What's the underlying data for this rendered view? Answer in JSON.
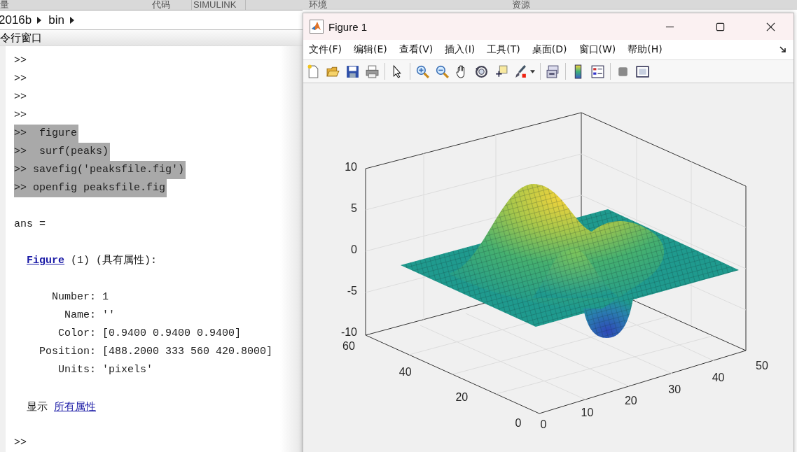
{
  "ribbon_tabs": [
    {
      "label": "量"
    },
    {
      "label": "代码"
    },
    {
      "label": "SIMULINK"
    },
    {
      "label": "环境"
    },
    {
      "label": "资源"
    }
  ],
  "breadcrumb": [
    "2016b",
    "bin"
  ],
  "panel_title": "令行窗口",
  "command_lines": [
    {
      "kind": "prompt",
      "prompt": ">>",
      "selected": false
    },
    {
      "kind": "prompt",
      "prompt": ">>",
      "selected": false
    },
    {
      "kind": "prompt",
      "prompt": ">>",
      "selected": false
    },
    {
      "kind": "prompt",
      "prompt": ">>",
      "selected": false
    },
    {
      "kind": "prompt",
      "prompt": ">>",
      "command": " figure",
      "selected": true
    },
    {
      "kind": "prompt",
      "prompt": ">>",
      "command": " surf(peaks)",
      "selected": true
    },
    {
      "kind": "prompt",
      "prompt": ">>",
      "command": "savefig('peaksfile.fig')",
      "selected": true
    },
    {
      "kind": "prompt",
      "prompt": ">>",
      "command": "openfig peaksfile.fig",
      "selected": true
    },
    {
      "kind": "blank"
    },
    {
      "kind": "text",
      "text": "ans ="
    },
    {
      "kind": "blank"
    },
    {
      "kind": "header",
      "link": "Figure",
      "text": "(1) (具有属性):"
    },
    {
      "kind": "blank"
    },
    {
      "kind": "property",
      "label": "Number:",
      "value": "1"
    },
    {
      "kind": "property",
      "label": "Name:",
      "value": "''"
    },
    {
      "kind": "property",
      "label": "Color:",
      "value": "[0.9400 0.9400 0.9400]"
    },
    {
      "kind": "property",
      "label": "Position:",
      "value": "[488.2000 333 560 420.8000]"
    },
    {
      "kind": "property",
      "label": "Units:",
      "value": "'pixels'"
    },
    {
      "kind": "blank"
    },
    {
      "kind": "links",
      "text": "显示",
      "link": "所有属性"
    },
    {
      "kind": "blank"
    },
    {
      "kind": "prompt",
      "prompt": ">>",
      "selected": false
    }
  ],
  "figure_window": {
    "title": "Figure 1",
    "menus": [
      "文件(F)",
      "编辑(E)",
      "查看(V)",
      "插入(I)",
      "工具(T)",
      "桌面(D)",
      "窗口(W)",
      "帮助(H)"
    ],
    "axes": {
      "z_ticks": [
        "10",
        "5",
        "0",
        "-5",
        "-10"
      ],
      "y_ticks": [
        "60",
        "40",
        "20",
        "0"
      ],
      "x_ticks": [
        "0",
        "10",
        "20",
        "30",
        "40",
        "50"
      ]
    }
  }
}
